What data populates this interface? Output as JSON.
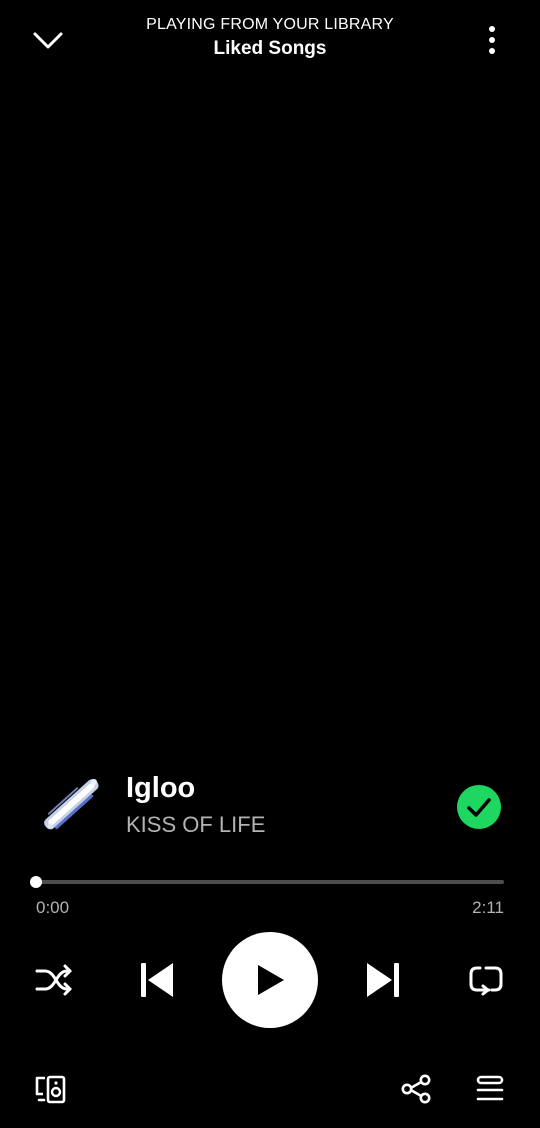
{
  "header": {
    "context_label": "PLAYING FROM YOUR LIBRARY",
    "context_name": "Liked Songs",
    "collapse_icon": "chevron-down-icon",
    "more_icon": "more-vertical-icon"
  },
  "track": {
    "title": "Igloo",
    "artist": "KISS OF LIFE",
    "liked": true
  },
  "progress": {
    "elapsed": "0:00",
    "total": "2:11",
    "fraction": 0.0
  },
  "controls": {
    "shuffle_icon": "shuffle-icon",
    "previous_icon": "skip-previous-icon",
    "play_icon": "play-icon",
    "next_icon": "skip-next-icon",
    "repeat_icon": "repeat-icon"
  },
  "footer": {
    "devices_icon": "connect-devices-icon",
    "share_icon": "share-icon",
    "queue_icon": "queue-icon"
  },
  "colors": {
    "background": "#000000",
    "accent": "#1ed760",
    "secondary_text": "#b3b3b3",
    "track": "#4d4d4d"
  }
}
